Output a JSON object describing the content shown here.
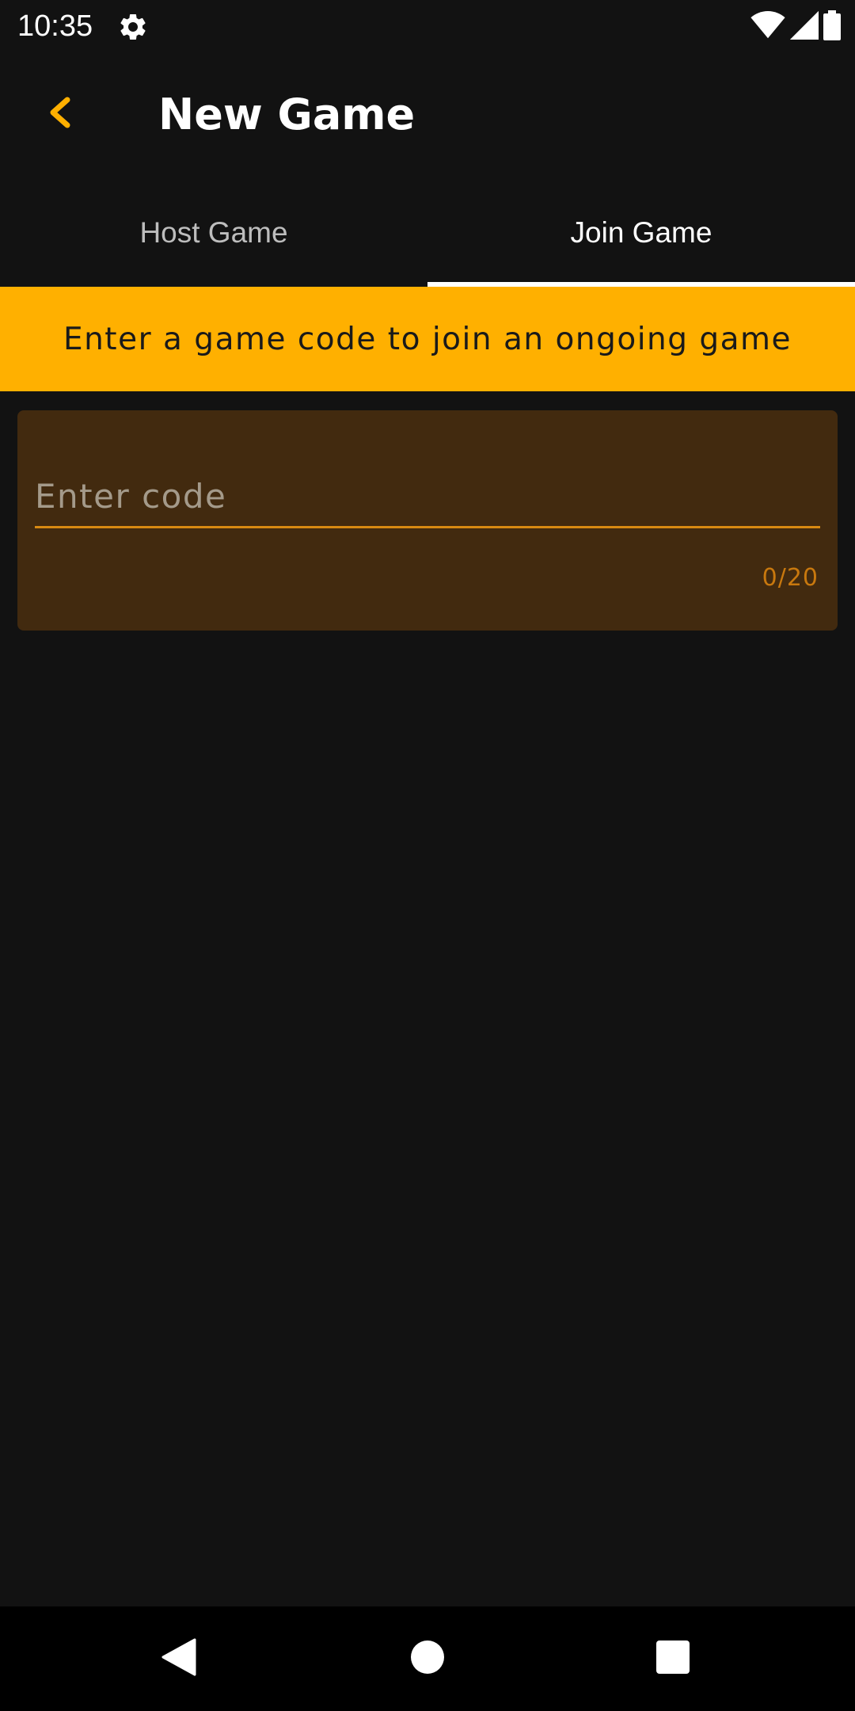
{
  "status_bar": {
    "time": "10:35",
    "icons": [
      "gear-icon",
      "wifi-icon",
      "signal-icon",
      "battery-icon"
    ]
  },
  "header": {
    "title": "New Game",
    "back_icon": "chevron-left-icon"
  },
  "tabs": [
    {
      "label": "Host Game",
      "active": false
    },
    {
      "label": "Join Game",
      "active": true
    }
  ],
  "banner": {
    "text": "Enter a game code to join an ongoing game"
  },
  "code_field": {
    "value": "",
    "placeholder": "Enter code",
    "counter": "0/20"
  },
  "nav_bar": {
    "icons": [
      "back-triangle-icon",
      "home-circle-icon",
      "recents-square-icon"
    ]
  },
  "colors": {
    "accent": "#FFB000",
    "background": "#121212",
    "field_background": "#422A0F",
    "field_underline": "#D88A12",
    "counter": "#C8780E"
  }
}
